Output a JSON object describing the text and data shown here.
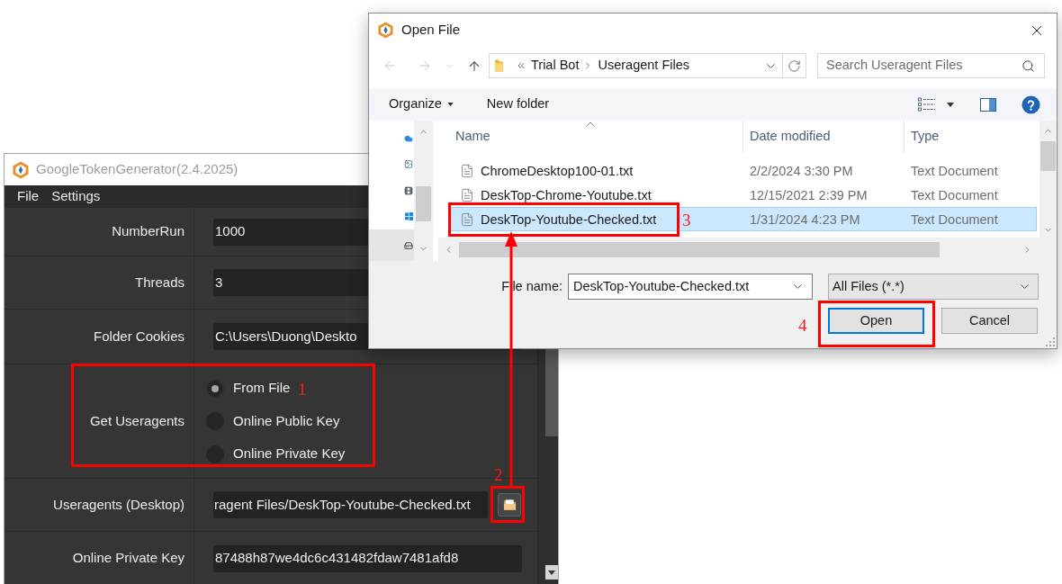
{
  "app_window": {
    "title": "GoogleTokenGenerator(2.4.2025)",
    "menu": [
      {
        "label": "File"
      },
      {
        "label": "Settings"
      }
    ],
    "fields": [
      {
        "kind": "text",
        "label": "NumberRun",
        "value": "1000"
      },
      {
        "kind": "text",
        "label": "Threads",
        "value": "3"
      },
      {
        "kind": "text",
        "label": "Folder Cookies",
        "value": "C:\\Users\\Duong\\Deskto"
      },
      {
        "kind": "radio",
        "label": "Get Useragents",
        "options": [
          {
            "label": "From File",
            "selected": true
          },
          {
            "label": "Online Public Key",
            "selected": false
          },
          {
            "label": "Online Private Key",
            "selected": false
          }
        ]
      },
      {
        "kind": "file",
        "label": "Useragents (Desktop)",
        "value": "ragent Files/DeskTop-Youtube-Checked.txt"
      },
      {
        "kind": "text",
        "label": "Online Private Key",
        "value": "87488h87we4dc6c431482fdaw7481afd8"
      }
    ]
  },
  "open_file_dialog": {
    "title": "Open File",
    "address": [
      "Trial Bot",
      "Useragent Files"
    ],
    "search": {
      "placeholder": "Search Useragent Files"
    },
    "toolbar": [
      {
        "kind": "menu",
        "label": "Organize"
      },
      {
        "kind": "button",
        "label": "New folder"
      }
    ],
    "navigation_pane": [
      {
        "selected": false
      },
      {
        "selected": false
      },
      {
        "selected": false
      },
      {
        "selected": false
      },
      {
        "selected": true
      }
    ],
    "columns": [
      {
        "label": "Name",
        "sorted": true
      },
      {
        "label": "Date modified",
        "sorted": false
      },
      {
        "label": "Type",
        "sorted": false
      }
    ],
    "files": [
      {
        "name": "ChromeDesktop100-01.txt",
        "date_modified": "2/2/2024 3:30 PM",
        "type": "Text Document",
        "selected": false
      },
      {
        "name": "DeskTop-Chrome-Youtube.txt",
        "date_modified": "12/15/2021 2:39 PM",
        "type": "Text Document",
        "selected": false
      },
      {
        "name": "DeskTop-Youtube-Checked.txt",
        "date_modified": "1/31/2024 4:23 PM",
        "type": "Text Document",
        "selected": true
      }
    ],
    "file_name": {
      "label": "File name:",
      "value": "DeskTop-Youtube-Checked.txt"
    },
    "file_type": {
      "value": "All Files (*.*)"
    },
    "buttons": [
      {
        "label": "Open",
        "default": true
      },
      {
        "label": "Cancel",
        "default": false
      }
    ]
  },
  "annotations": [
    {
      "label": "1"
    },
    {
      "label": "2"
    },
    {
      "label": "3"
    },
    {
      "label": "4"
    }
  ]
}
